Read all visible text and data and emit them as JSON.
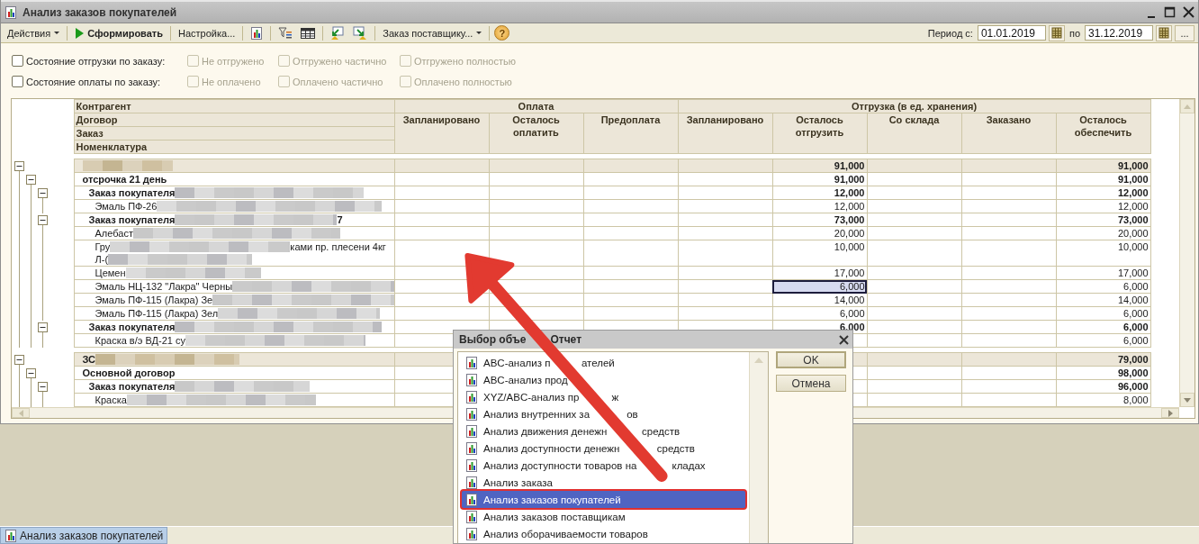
{
  "window": {
    "title": "Анализ заказов покупателей"
  },
  "toolbar": {
    "actions_menu": "Действия",
    "run_button": "Сформировать",
    "settings_button": "Настройка...",
    "order_menu": "Заказ поставщику...",
    "help_button": "?"
  },
  "period": {
    "label": "Период с:",
    "from": "01.01.2019",
    "to_label": "по",
    "to": "31.12.2019",
    "more_button": "..."
  },
  "filters": [
    {
      "label": "Состояние отгрузки по заказу:",
      "checked": false,
      "options": [
        {
          "label": "Не отгружено",
          "checked": false,
          "disabled": true
        },
        {
          "label": "Отгружено частично",
          "checked": false,
          "disabled": true
        },
        {
          "label": "Отгружено полностью",
          "checked": false,
          "disabled": true
        }
      ]
    },
    {
      "label": "Состояние оплаты по заказу:",
      "checked": false,
      "options": [
        {
          "label": "Не оплачено",
          "checked": false,
          "disabled": true
        },
        {
          "label": "Оплачено частично",
          "checked": false,
          "disabled": true
        },
        {
          "label": "Оплачено полностью",
          "checked": false,
          "disabled": true
        }
      ]
    }
  ],
  "report": {
    "group_levels": [
      "Контрагент",
      "Договор",
      "Заказ",
      "Номенклатура"
    ],
    "groups": [
      {
        "title": "Оплата",
        "columns": [
          "Запланировано",
          "Осталось оплатить",
          "Предоплата"
        ]
      },
      {
        "title": "Отгрузка (в ед. хранения)",
        "columns": [
          "Запланировано",
          "Осталось отгрузить",
          "Со склада",
          "Заказано",
          "Осталось обеспечить"
        ]
      }
    ],
    "rows": [
      {
        "kind": "contractor",
        "expanded": true,
        "lines": [
          {
            "redacted": true
          }
        ],
        "ship": "91,000",
        "provide": "91,000",
        "focused": false,
        "children": [
          {
            "kind": "contract",
            "expanded": true,
            "lines": [
              {
                "text": "отсрочка 21 день",
                "redacted": false
              }
            ],
            "ship": "91,000",
            "provide": "91,000",
            "focused": false,
            "children": [
              {
                "kind": "order",
                "expanded": true,
                "lines": [
                  {
                    "text": "Заказ покупателя",
                    "redacted": true
                  }
                ],
                "ship": "12,000",
                "provide": "12,000",
                "focused": false,
                "children": [
                  {
                    "kind": "item",
                    "lines": [
                      {
                        "text": "Эмаль ПФ-26",
                        "redacted": true
                      }
                    ],
                    "ship": "12,000",
                    "provide": "12,000",
                    "focused": false
                  }
                ]
              },
              {
                "kind": "order",
                "expanded": true,
                "lines": [
                  {
                    "text": "Заказ покупателя",
                    "redacted": true,
                    "after": "7"
                  }
                ],
                "ship": "73,000",
                "provide": "73,000",
                "focused": false,
                "children": [
                  {
                    "kind": "item",
                    "lines": [
                      {
                        "text": "Алебаст",
                        "redacted": true
                      }
                    ],
                    "ship": "20,000",
                    "provide": "20,000",
                    "focused": false
                  },
                  {
                    "kind": "item",
                    "lines": [
                      {
                        "text": "Гру",
                        "redacted": true,
                        "after": "ками пр. плесени 4кг"
                      },
                      {
                        "text": "Л-(",
                        "redacted": true
                      }
                    ],
                    "ship": "10,000",
                    "provide": "10,000",
                    "focused": false
                  },
                  {
                    "kind": "item",
                    "lines": [
                      {
                        "text": "Цемен",
                        "redacted": true
                      }
                    ],
                    "ship": "17,000",
                    "provide": "17,000",
                    "focused": false
                  },
                  {
                    "kind": "item",
                    "lines": [
                      {
                        "text": "Эмаль НЦ-132 \"Лакра\" Черны",
                        "redacted": true
                      }
                    ],
                    "ship": "6,000",
                    "provide": "6,000",
                    "focused": true
                  },
                  {
                    "kind": "item",
                    "lines": [
                      {
                        "text": "Эмаль ПФ-115 (Лакра) Зе",
                        "redacted": true
                      }
                    ],
                    "ship": "14,000",
                    "provide": "14,000",
                    "focused": false
                  },
                  {
                    "kind": "item",
                    "lines": [
                      {
                        "text": "Эмаль ПФ-115 (Лакра) Зел",
                        "redacted": true
                      }
                    ],
                    "ship": "6,000",
                    "provide": "6,000",
                    "focused": false
                  }
                ]
              },
              {
                "kind": "order",
                "expanded": true,
                "lines": [
                  {
                    "text": "Заказ покупателя",
                    "redacted": true
                  }
                ],
                "ship": "6,000",
                "provide": "6,000",
                "focused": false,
                "children": [
                  {
                    "kind": "item",
                    "lines": [
                      {
                        "text": "Краска в/э ВД-21 су",
                        "redacted": true
                      }
                    ],
                    "provide": "6,000",
                    "focused": false
                  }
                ]
              }
            ]
          }
        ]
      },
      {
        "kind": "contractor",
        "expanded": true,
        "lines": [
          {
            "text": "ЗС",
            "redacted": true
          }
        ],
        "provide": "79,000",
        "focused": false,
        "children": [
          {
            "kind": "contract",
            "expanded": true,
            "lines": [
              {
                "text": "Основной договор",
                "redacted": false
              }
            ],
            "provide": "98,000",
            "focused": false,
            "children": [
              {
                "kind": "order",
                "expanded": true,
                "lines": [
                  {
                    "text": "Заказ покупателя",
                    "redacted": true
                  }
                ],
                "provide": "96,000",
                "focused": false,
                "children": [
                  {
                    "kind": "item",
                    "lines": [
                      {
                        "text": "Краска",
                        "redacted": true
                      }
                    ],
                    "provide": "8,000",
                    "focused": false
                  }
                ]
              }
            ]
          }
        ]
      }
    ]
  },
  "dialog": {
    "title": "Выбор объе",
    "title_tail": "Отчет",
    "items": [
      {
        "label": "ABC-анализ п",
        "tail": "ателей",
        "selected": false
      },
      {
        "label": "ABC-анализ прод",
        "selected": false
      },
      {
        "label": "XYZ/ABC-анализ пр",
        "tail": "ж",
        "selected": false
      },
      {
        "label": "Анализ внутренних за",
        "tail": "ов",
        "selected": false
      },
      {
        "label": "Анализ движения денежн",
        "tail": "средств",
        "selected": false
      },
      {
        "label": "Анализ доступности денежн",
        "tail": "средств",
        "selected": false
      },
      {
        "label": "Анализ доступности товаров на",
        "tail": "кладах",
        "selected": false
      },
      {
        "label": "Анализ заказа",
        "selected": false
      },
      {
        "label": "Анализ заказов покупателей",
        "selected": true
      },
      {
        "label": "Анализ заказов поставщикам",
        "selected": false
      },
      {
        "label": "Анализ оборачиваемости товаров",
        "selected": false
      }
    ],
    "buttons": [
      "OK",
      "Отмена"
    ]
  },
  "taskbar": [
    {
      "label": "Анализ заказов покупателей",
      "selected": true
    }
  ]
}
